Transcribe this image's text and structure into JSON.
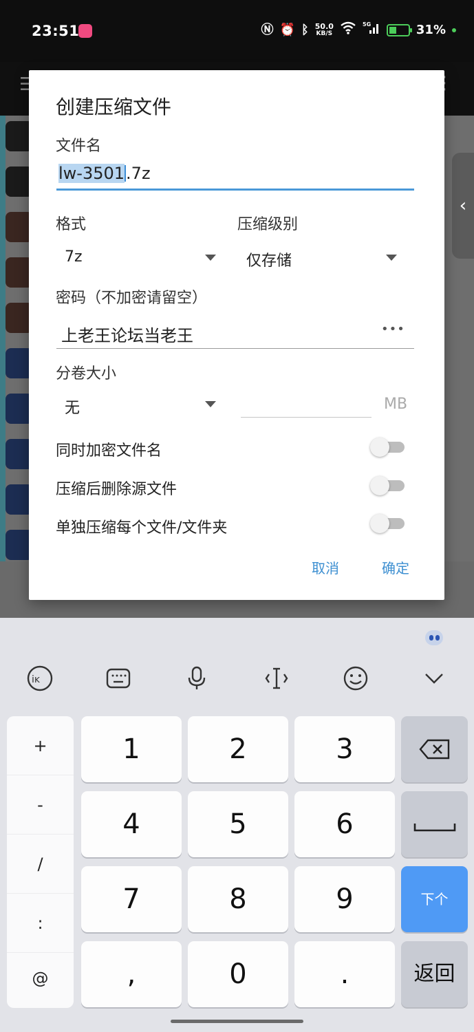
{
  "status_bar": {
    "time": "23:51",
    "network_speed_value": "50.0",
    "network_speed_unit": "KB/S",
    "battery": "31%",
    "icons": [
      "nfc-icon",
      "alarm-icon",
      "bluetooth-icon",
      "wifi-icon",
      "5g-signal-icon",
      "battery-icon"
    ]
  },
  "dialog": {
    "title": "创建压缩文件",
    "filename_label": "文件名",
    "filename_selected": "lw-3501",
    "filename_rest": ".7z",
    "format_label": "格式",
    "format_value": "7z",
    "level_label": "压缩级别",
    "level_value": "仅存储",
    "password_label": "密码（不加密请留空）",
    "password_value": "上老王论坛当老王",
    "password_mask": "•••",
    "volume_label": "分卷大小",
    "volume_value": "无",
    "volume_size_value": "",
    "volume_unit": "MB",
    "toggles": [
      {
        "label": "同时加密文件名",
        "on": false
      },
      {
        "label": "压缩后删除源文件",
        "on": false
      },
      {
        "label": "单独压缩每个文件/文件夹",
        "on": false
      }
    ],
    "cancel_label": "取消",
    "confirm_label": "确定"
  },
  "keyboard": {
    "symbols": [
      "+",
      "-",
      "/",
      ":",
      "@"
    ],
    "digits_row1": [
      "1",
      "2",
      "3"
    ],
    "digits_row2": [
      "4",
      "5",
      "6"
    ],
    "digits_row3": [
      "7",
      "8",
      "9"
    ],
    "digits_row4": [
      ",",
      "0",
      "."
    ],
    "next_label": "下个",
    "return_label": "返回",
    "accent_color": "#4f9af5"
  }
}
